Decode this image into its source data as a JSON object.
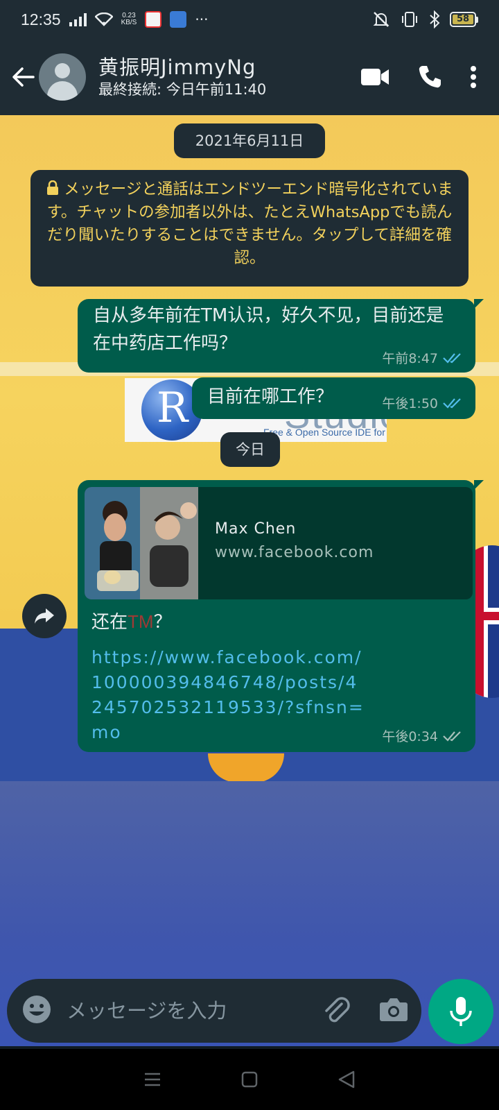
{
  "status_bar": {
    "time": "12:35",
    "net_speed_value": "0.23",
    "net_speed_unit": "KB/S",
    "more": "···",
    "battery": "58"
  },
  "header": {
    "contact_name": "黄振明JimmyNg",
    "last_seen": "最終接続: 今日午前11:40",
    "icons": [
      "back-arrow",
      "avatar",
      "video-call",
      "voice-call",
      "more-vertical"
    ]
  },
  "chat": {
    "date_chip_1": "2021年6月11日",
    "encryption_notice": "メッセージと通話はエンドツーエンド暗号化されています。チャットの参加者以外は、たとえWhatsAppでも読んだり聞いたりすることはできません。タップして詳細を確認。",
    "messages": [
      {
        "text": "自从多年前在TM认识，好久不见，目前还是在中药店工作吗？",
        "time": "午前8:47",
        "status": "read"
      },
      {
        "text": "目前在哪工作？",
        "time": "午後1:50",
        "status": "read"
      }
    ],
    "date_chip_2": "今日",
    "link_message": {
      "preview_title": "Max Chen",
      "preview_domain": "www.facebook.com",
      "text_prefix": "还在",
      "text_highlight": "TM",
      "text_suffix": "？",
      "url": "https://www.facebook.com/100000394846748/posts/4245702532119533/?sfnsn=mo",
      "time": "午後0:34",
      "status": "delivered"
    }
  },
  "input": {
    "placeholder": "メッセージを入力"
  },
  "colors": {
    "header_bg": "#1f2c34",
    "outgoing_bubble": "#005c4b",
    "accent_green": "#00a884",
    "read_tick": "#53bdeb",
    "notice_text": "#f2d15c"
  }
}
